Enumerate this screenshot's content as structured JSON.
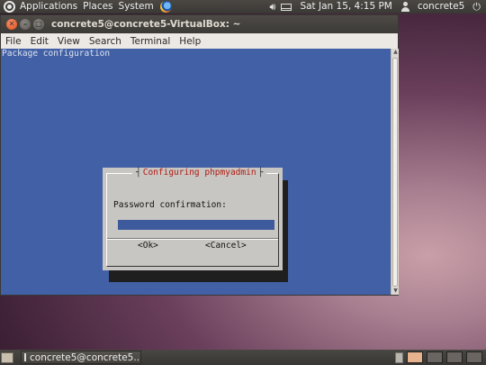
{
  "top_panel": {
    "applications": "Applications",
    "places": "Places",
    "system": "System",
    "datetime": "Sat Jan 15, 4:15 PM",
    "user": "concrete5",
    "icons": [
      "ubuntu-logo-icon",
      "firefox-icon",
      "volume-icon",
      "mail-icon",
      "person-icon",
      "power-icon"
    ]
  },
  "terminal": {
    "title": "concrete5@concrete5-VirtualBox: ~",
    "menu": [
      "File",
      "Edit",
      "View",
      "Search",
      "Terminal",
      "Help"
    ],
    "screen_heading": "Package configuration",
    "background_color": "#4260a6"
  },
  "dialog": {
    "title": "Configuring phpmyadmin",
    "label": "Password confirmation:",
    "password_value": "",
    "ok": "<Ok>",
    "cancel": "<Cancel>",
    "title_color": "#b11a12"
  },
  "bottom_panel": {
    "task": "concrete5@concrete5..."
  }
}
